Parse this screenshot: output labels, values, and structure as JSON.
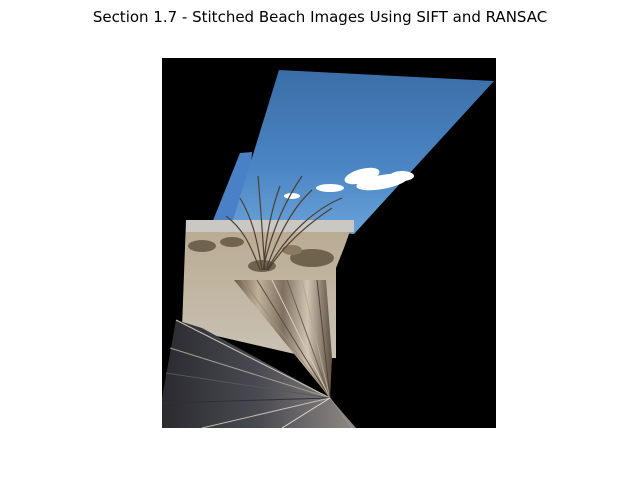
{
  "figure": {
    "title": "Section 1.7 - Stitched Beach Images Using SIFT and RANSAC"
  },
  "image": {
    "subject": "panorama",
    "colors": {
      "background": "#000000",
      "sky": "#3f78b8",
      "sky_light": "#5a96d0",
      "cloud": "#ffffff",
      "sand": "#b7aa97",
      "brush": "#7a6a55",
      "shadow": "#2e2e33"
    }
  }
}
